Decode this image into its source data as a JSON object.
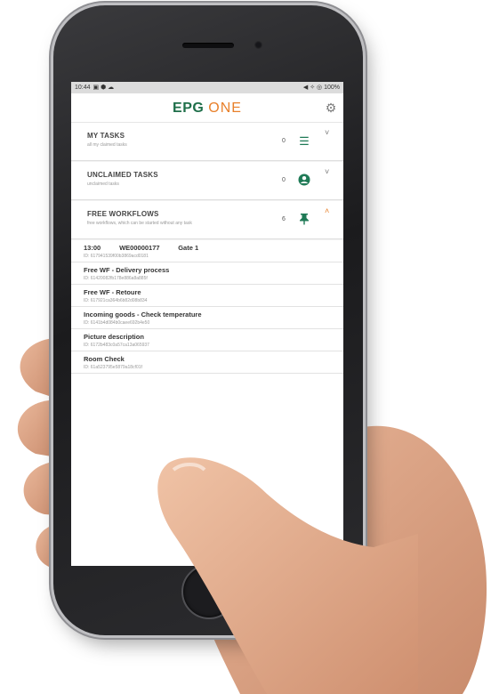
{
  "status_bar": {
    "time": "10:44",
    "left_icons": "▣ ⬢ ☁",
    "right_text": "◀ ✧ ◎ 100%"
  },
  "app": {
    "logo_left": "EPG",
    "logo_right": "ONE"
  },
  "sections": [
    {
      "title": "MY TASKS",
      "subtitle": "all my claimed tasks",
      "count": "0",
      "icon": "checklist-icon",
      "glyph": "☰",
      "chevron": "˅"
    },
    {
      "title": "UNCLAIMED TASKS",
      "subtitle": "unclaimed tasks",
      "count": "0",
      "icon": "person-circle-icon",
      "glyph": "●",
      "chevron": "˅"
    },
    {
      "title": "FREE WORKFLOWS",
      "subtitle": "free workflows, which can be started without any task",
      "count": "6",
      "icon": "pin-icon",
      "glyph": "📌",
      "chevron": "˄"
    }
  ],
  "workflows": [
    {
      "name": "13:00",
      "name2": "WE00000177",
      "name3": "Gate 1",
      "id": "ID: 617941539f00b3869acd0181"
    },
    {
      "name": "Free WF - Delivery process",
      "id": "ID: 61420082fb178e886a8a885f"
    },
    {
      "name": "Free WF - Retoure",
      "id": "ID: 617921ca364b6b82d08b834"
    },
    {
      "name": "Incoming goods - Check temperature",
      "id": "ID: 6141b4d084b0caee692b4e50"
    },
    {
      "name": "Picture description",
      "id": "ID: 6172b483c0a57ca13a065937"
    },
    {
      "name": "Room Check",
      "id": "ID: 61a523795e5879a18cf01f"
    }
  ],
  "colors": {
    "brand_green": "#1f6f4a",
    "brand_orange": "#e8802b"
  }
}
